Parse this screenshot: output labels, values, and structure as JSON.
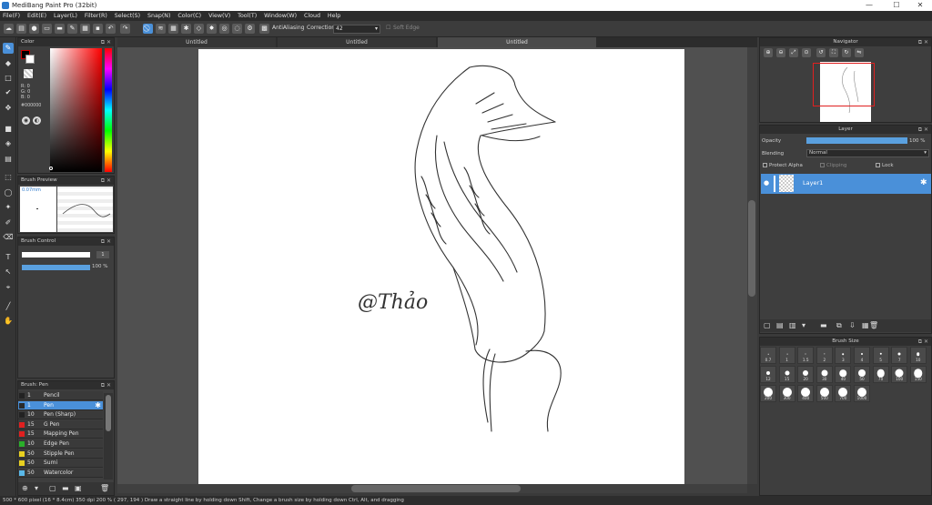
{
  "window": {
    "title": "MediBang Paint Pro (32bit)",
    "minimize": "—",
    "maximize": "☐",
    "close": "✕"
  },
  "menu": [
    "File(F)",
    "Edit(E)",
    "Layer(L)",
    "Filter(R)",
    "Select(S)",
    "Snap(N)",
    "Color(C)",
    "View(V)",
    "Tool(T)",
    "Window(W)",
    "Cloud",
    "Help"
  ],
  "toolbar": {
    "antialiasing": "AntiAliasing",
    "correction_label": "Correction",
    "correction_value": "42",
    "soft_edge": "Soft Edge"
  },
  "doc_tabs": [
    "Untitled",
    "Untitled",
    "Untitled"
  ],
  "color_panel": {
    "title": "Color",
    "r": "R: 0",
    "g": "G: 0",
    "b": "B: 0",
    "hex": "#000000"
  },
  "brush_preview": {
    "title": "Brush Preview",
    "size": "0.07mm"
  },
  "brush_control": {
    "title": "Brush Control",
    "size_value": "1",
    "opacity_value": "100 %"
  },
  "brush_list": {
    "title": "Brush: Pen",
    "items": [
      {
        "size": "1",
        "name": "Pencil",
        "color": "#222222"
      },
      {
        "size": "1",
        "name": "Pen",
        "color": "#2a2a2a"
      },
      {
        "size": "10",
        "name": "Pen (Sharp)",
        "color": "#222222"
      },
      {
        "size": "15",
        "name": "G Pen",
        "color": "#e02020"
      },
      {
        "size": "15",
        "name": "Mapping Pen",
        "color": "#e02020"
      },
      {
        "size": "10",
        "name": "Edge Pen",
        "color": "#2ab02a"
      },
      {
        "size": "50",
        "name": "Stipple Pen",
        "color": "#e8d020"
      },
      {
        "size": "50",
        "name": "Sumi",
        "color": "#e8d020"
      },
      {
        "size": "50",
        "name": "Watercolor",
        "color": "#5ab8e8"
      }
    ]
  },
  "navigator": {
    "title": "Navigator"
  },
  "layer_panel": {
    "title": "Layer",
    "opacity_label": "Opacity",
    "opacity_value": "100 %",
    "blending_label": "Blending",
    "blending_value": "Normal",
    "protect_alpha": "Protect Alpha",
    "clipping": "Clipping",
    "lock": "Lock",
    "layer_name": "Layer1"
  },
  "brush_size": {
    "title": "Brush Size",
    "values": [
      "0.7",
      "1",
      "1.5",
      "2",
      "3",
      "4",
      "5",
      "7",
      "10",
      "12",
      "15",
      "20",
      "30",
      "40",
      "50",
      "70",
      "100",
      "150",
      "200",
      "300",
      "400",
      "500",
      "700",
      "1000"
    ]
  },
  "canvas": {
    "watermark": "@Thảo"
  },
  "status": {
    "text": "500 * 600 pixel   (16 * 8.4cm)   350 dpi   200 %   ( 297, 194 )   Draw a straight line by holding down Shift, Change a brush size by holding down Ctrl, Alt, and dragging"
  }
}
